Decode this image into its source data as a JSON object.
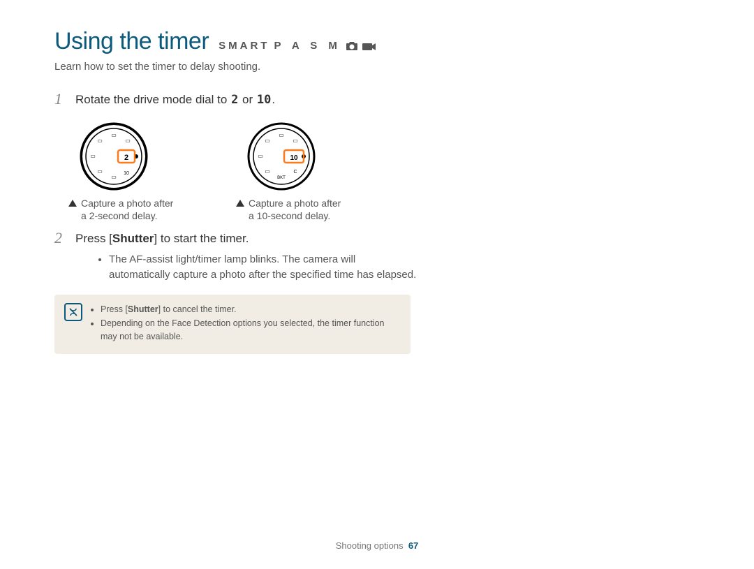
{
  "header": {
    "title": "Using the timer",
    "modes_prefix": "SMART",
    "modes_letters": "P A S M",
    "subtitle": "Learn how to set the timer to delay shooting."
  },
  "steps": [
    {
      "num": "1",
      "text_before": "Rotate the drive mode dial to ",
      "glyph_a": "2",
      "text_mid": " or ",
      "glyph_b": "10",
      "text_after": "."
    },
    {
      "num": "2",
      "text_before": "Press [",
      "bold": "Shutter",
      "text_after": "] to start the timer."
    }
  ],
  "dial_captions": {
    "left_line1": "Capture a photo after",
    "left_line2": "a 2-second delay.",
    "right_line1": "Capture a photo after",
    "right_line2": "a 10-second delay."
  },
  "sub_bullets": [
    "The AF-assist light/timer lamp blinks. The camera will automatically capture a photo after the specified time has elapsed."
  ],
  "note": {
    "items": [
      {
        "pre": "Press [",
        "bold": "Shutter",
        "post": "] to cancel the timer."
      },
      {
        "pre": "Depending on the Face Detection options you selected, the timer function may not be available.",
        "bold": "",
        "post": ""
      }
    ]
  },
  "footer": {
    "section": "Shooting options",
    "page": "67"
  },
  "dial": {
    "left_label": "2",
    "right_label": "10"
  }
}
